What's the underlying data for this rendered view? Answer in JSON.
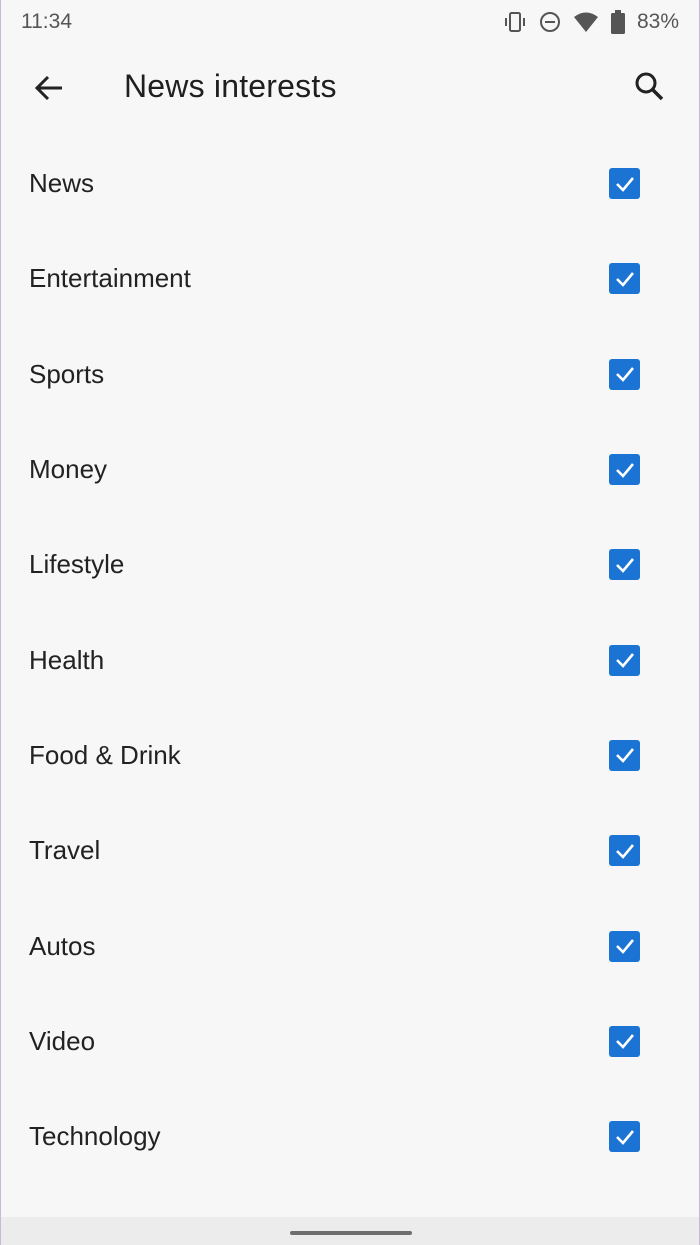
{
  "status_bar": {
    "time": "11:34",
    "battery": "83%",
    "icons": [
      "vibrate-icon",
      "dnd-icon",
      "wifi-icon",
      "battery-icon"
    ]
  },
  "app_bar": {
    "title": "News interests",
    "back_icon": "arrow-back-icon",
    "search_icon": "search-icon"
  },
  "colors": {
    "accent": "#1b74d4",
    "background": "#f7f7f7"
  },
  "interests": [
    {
      "label": "News",
      "checked": true
    },
    {
      "label": "Entertainment",
      "checked": true
    },
    {
      "label": "Sports",
      "checked": true
    },
    {
      "label": "Money",
      "checked": true
    },
    {
      "label": "Lifestyle",
      "checked": true
    },
    {
      "label": "Health",
      "checked": true
    },
    {
      "label": "Food & Drink",
      "checked": true
    },
    {
      "label": "Travel",
      "checked": true
    },
    {
      "label": "Autos",
      "checked": true
    },
    {
      "label": "Video",
      "checked": true
    },
    {
      "label": "Technology",
      "checked": true
    }
  ]
}
